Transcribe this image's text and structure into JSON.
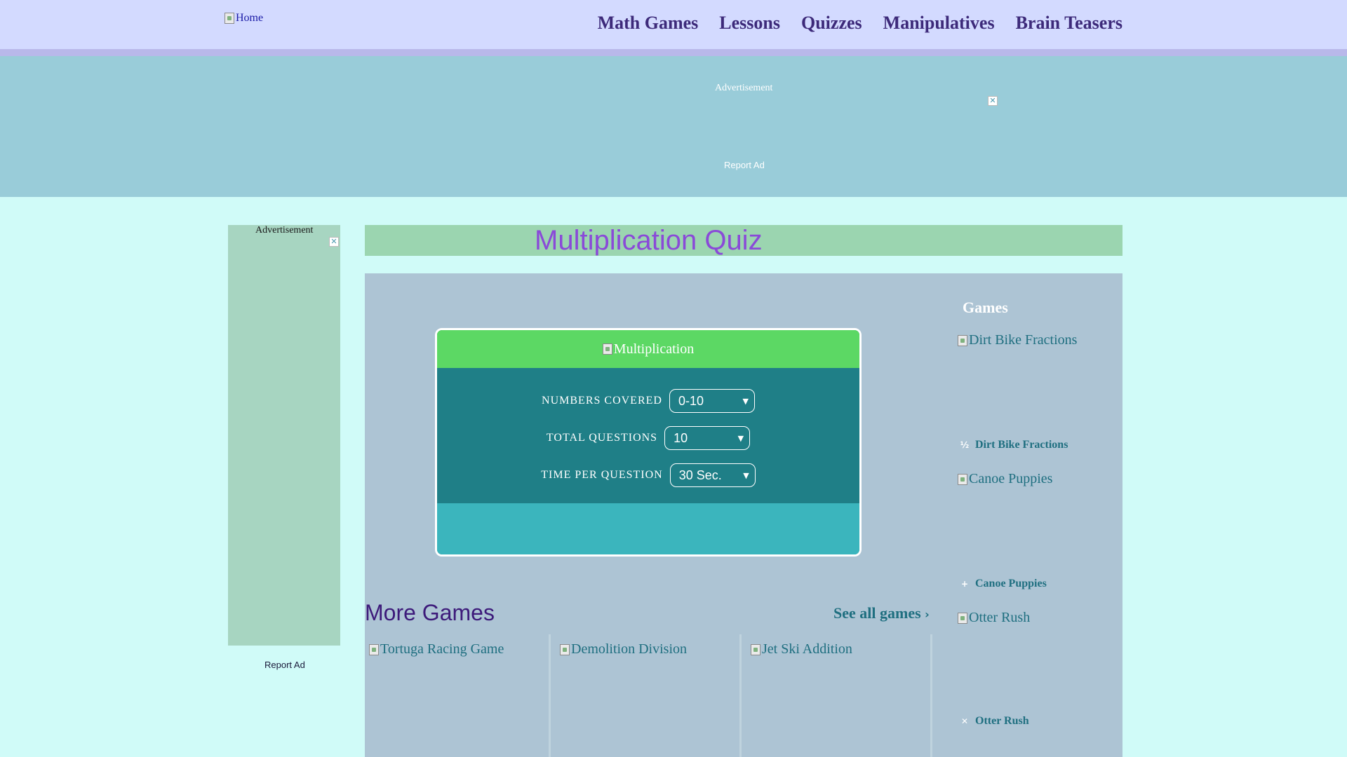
{
  "header": {
    "logo_alt": "Home",
    "nav": [
      "Math Games",
      "Lessons",
      "Quizzes",
      "Manipulatives",
      "Brain Teasers"
    ]
  },
  "ads": {
    "label": "Advertisement",
    "report": "Report Ad",
    "close_glyph": "✕"
  },
  "quiz": {
    "title": "Multiplication Quiz",
    "card_image_alt": "Multiplication",
    "settings": [
      {
        "label": "NUMBERS COVERED",
        "value": "0-10"
      },
      {
        "label": "TOTAL QUESTIONS",
        "value": "10"
      },
      {
        "label": "TIME PER QUESTION",
        "value": "30 Sec."
      }
    ]
  },
  "more_games": {
    "title": "More Games",
    "see_all": "See all games",
    "tiles": [
      "Tortuga Racing Game",
      "Demolition Division",
      "Jet Ski Addition"
    ]
  },
  "sidebar": {
    "title": "Games",
    "items": [
      {
        "image_alt": "Dirt Bike Fractions",
        "caption": "Dirt Bike Fractions",
        "icon": "½"
      },
      {
        "image_alt": "Canoe Puppies",
        "caption": "Canoe Puppies",
        "icon": "+"
      },
      {
        "image_alt": "Otter Rush",
        "caption": "Otter Rush",
        "icon": "✕"
      }
    ]
  },
  "colors": {
    "header_bg": "#d3daff",
    "page_bg": "#d0fbf8",
    "title_purple": "#8a4ad8",
    "quiz_green": "#5cd864",
    "quiz_teal": "#1f7f87"
  }
}
